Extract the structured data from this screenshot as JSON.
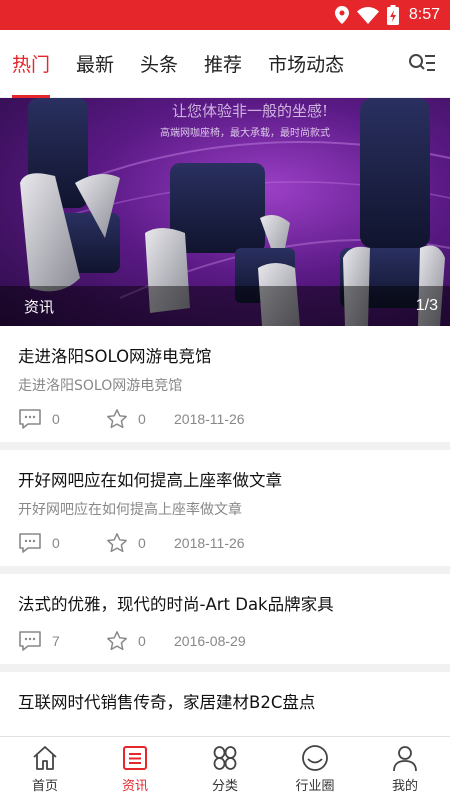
{
  "status_bar": {
    "time": "8:57",
    "icons": [
      "location-icon",
      "wifi-icon",
      "battery-charging-icon"
    ]
  },
  "tabs": [
    {
      "label": "热门",
      "active": true
    },
    {
      "label": "最新",
      "active": false
    },
    {
      "label": "头条",
      "active": false
    },
    {
      "label": "推荐",
      "active": false
    },
    {
      "label": "市场动态",
      "active": false
    }
  ],
  "tab_menu_icon": "search-list-icon",
  "banner": {
    "headline": "让您体验非一般的坐感!",
    "subline": "高端网咖座椅，最大承载，最时尚款式",
    "caption": "资讯",
    "pager": "1/3"
  },
  "news": [
    {
      "title": "走进洛阳SOLO网游电竞馆",
      "subtitle": "走进洛阳SOLO网游电竞馆",
      "comments": "0",
      "favorites": "0",
      "date": "2018-11-26"
    },
    {
      "title": "开好网吧应在如何提高上座率做文章",
      "subtitle": "开好网吧应在如何提高上座率做文章",
      "comments": "0",
      "favorites": "0",
      "date": "2018-11-26"
    },
    {
      "title": "法式的优雅，现代的时尚-Art Dak品牌家具",
      "subtitle": "",
      "comments": "7",
      "favorites": "0",
      "date": "2016-08-29"
    },
    {
      "title": "互联网时代销售传奇，家居建材B2C盘点",
      "subtitle": "",
      "comments": "",
      "favorites": "",
      "date": ""
    }
  ],
  "bottom_nav": [
    {
      "label": "首页",
      "icon": "home-icon",
      "active": false
    },
    {
      "label": "资讯",
      "icon": "news-icon",
      "active": true
    },
    {
      "label": "分类",
      "icon": "category-icon",
      "active": false
    },
    {
      "label": "行业圈",
      "icon": "circle-icon",
      "active": false
    },
    {
      "label": "我的",
      "icon": "user-icon",
      "active": false
    }
  ],
  "colors": {
    "accent": "#e5262b",
    "muted": "#888888"
  }
}
